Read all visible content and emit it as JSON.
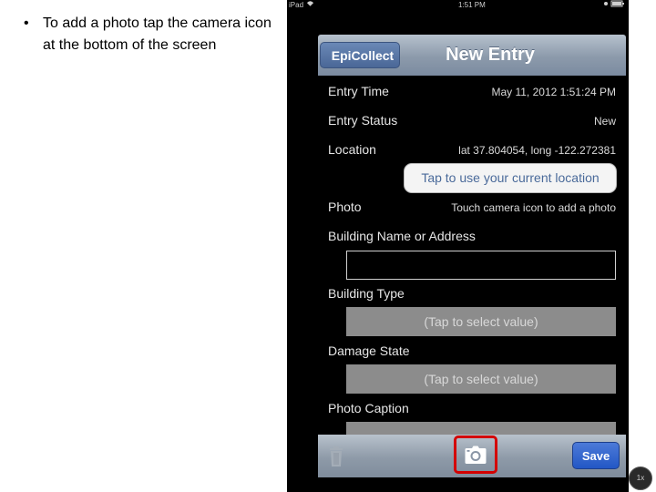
{
  "slide": {
    "bullet": "•",
    "text": "To add a photo tap the camera icon at the bottom of the screen"
  },
  "status_bar": {
    "carrier": "iPad",
    "time": "1:51 PM",
    "battery_icon": "battery-icon",
    "wifi_icon": "wifi-icon"
  },
  "navbar": {
    "back_label": "EpiCollect",
    "title": "New Entry"
  },
  "form": {
    "entry_time_label": "Entry Time",
    "entry_time_value": "May 11, 2012 1:51:24 PM",
    "entry_status_label": "Entry Status",
    "entry_status_value": "New",
    "location_label": "Location",
    "location_value": "lat 37.804054, long -122.272381",
    "location_button": "Tap to use your current location",
    "photo_label": "Photo",
    "photo_value": "Touch camera icon to add a photo",
    "building_label": "Building Name or Address",
    "building_value": "",
    "building_type_label": "Building Type",
    "building_type_value": "(Tap to select value)",
    "damage_state_label": "Damage State",
    "damage_state_value": "(Tap to select value)",
    "photo_caption_label": "Photo Caption"
  },
  "toolbar": {
    "save_label": "Save",
    "trash_icon": "trash-icon",
    "camera_icon": "camera-icon"
  },
  "zoom_badge": "1x",
  "colors": {
    "highlight": "#d40000",
    "save_button": "#2f63cc",
    "navbar": "#9aa8b8"
  }
}
